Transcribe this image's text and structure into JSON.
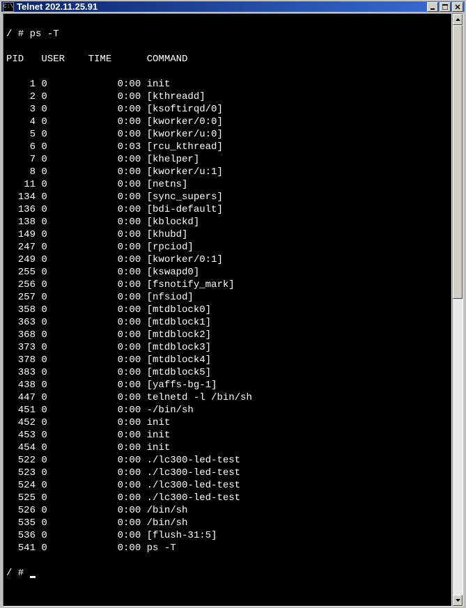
{
  "window": {
    "icon_text": "C:\\",
    "title": "Telnet 202.11.25.91"
  },
  "terminal": {
    "prompt1": "/ # ps -T",
    "header": {
      "pid": "PID",
      "user": "USER",
      "time": "TIME",
      "command": "COMMAND"
    },
    "rows": [
      {
        "pid": "1",
        "user": "0",
        "time": "0:00",
        "command": "init"
      },
      {
        "pid": "2",
        "user": "0",
        "time": "0:00",
        "command": "[kthreadd]"
      },
      {
        "pid": "3",
        "user": "0",
        "time": "0:00",
        "command": "[ksoftirqd/0]"
      },
      {
        "pid": "4",
        "user": "0",
        "time": "0:00",
        "command": "[kworker/0:0]"
      },
      {
        "pid": "5",
        "user": "0",
        "time": "0:00",
        "command": "[kworker/u:0]"
      },
      {
        "pid": "6",
        "user": "0",
        "time": "0:03",
        "command": "[rcu_kthread]"
      },
      {
        "pid": "7",
        "user": "0",
        "time": "0:00",
        "command": "[khelper]"
      },
      {
        "pid": "8",
        "user": "0",
        "time": "0:00",
        "command": "[kworker/u:1]"
      },
      {
        "pid": "11",
        "user": "0",
        "time": "0:00",
        "command": "[netns]"
      },
      {
        "pid": "134",
        "user": "0",
        "time": "0:00",
        "command": "[sync_supers]"
      },
      {
        "pid": "136",
        "user": "0",
        "time": "0:00",
        "command": "[bdi-default]"
      },
      {
        "pid": "138",
        "user": "0",
        "time": "0:00",
        "command": "[kblockd]"
      },
      {
        "pid": "149",
        "user": "0",
        "time": "0:00",
        "command": "[khubd]"
      },
      {
        "pid": "247",
        "user": "0",
        "time": "0:00",
        "command": "[rpciod]"
      },
      {
        "pid": "249",
        "user": "0",
        "time": "0:00",
        "command": "[kworker/0:1]"
      },
      {
        "pid": "255",
        "user": "0",
        "time": "0:00",
        "command": "[kswapd0]"
      },
      {
        "pid": "256",
        "user": "0",
        "time": "0:00",
        "command": "[fsnotify_mark]"
      },
      {
        "pid": "257",
        "user": "0",
        "time": "0:00",
        "command": "[nfsiod]"
      },
      {
        "pid": "358",
        "user": "0",
        "time": "0:00",
        "command": "[mtdblock0]"
      },
      {
        "pid": "363",
        "user": "0",
        "time": "0:00",
        "command": "[mtdblock1]"
      },
      {
        "pid": "368",
        "user": "0",
        "time": "0:00",
        "command": "[mtdblock2]"
      },
      {
        "pid": "373",
        "user": "0",
        "time": "0:00",
        "command": "[mtdblock3]"
      },
      {
        "pid": "378",
        "user": "0",
        "time": "0:00",
        "command": "[mtdblock4]"
      },
      {
        "pid": "383",
        "user": "0",
        "time": "0:00",
        "command": "[mtdblock5]"
      },
      {
        "pid": "438",
        "user": "0",
        "time": "0:00",
        "command": "[yaffs-bg-1]"
      },
      {
        "pid": "447",
        "user": "0",
        "time": "0:00",
        "command": "telnetd -l /bin/sh"
      },
      {
        "pid": "451",
        "user": "0",
        "time": "0:00",
        "command": "-/bin/sh"
      },
      {
        "pid": "452",
        "user": "0",
        "time": "0:00",
        "command": "init"
      },
      {
        "pid": "453",
        "user": "0",
        "time": "0:00",
        "command": "init"
      },
      {
        "pid": "454",
        "user": "0",
        "time": "0:00",
        "command": "init"
      },
      {
        "pid": "522",
        "user": "0",
        "time": "0:00",
        "command": "./lc300-led-test"
      },
      {
        "pid": "523",
        "user": "0",
        "time": "0:00",
        "command": "./lc300-led-test"
      },
      {
        "pid": "524",
        "user": "0",
        "time": "0:00",
        "command": "./lc300-led-test"
      },
      {
        "pid": "525",
        "user": "0",
        "time": "0:00",
        "command": "./lc300-led-test"
      },
      {
        "pid": "526",
        "user": "0",
        "time": "0:00",
        "command": "/bin/sh"
      },
      {
        "pid": "535",
        "user": "0",
        "time": "0:00",
        "command": "/bin/sh"
      },
      {
        "pid": "536",
        "user": "0",
        "time": "0:00",
        "command": "[flush-31:5]"
      },
      {
        "pid": "541",
        "user": "0",
        "time": "0:00",
        "command": "ps -T"
      }
    ],
    "prompt2": "/ # "
  }
}
